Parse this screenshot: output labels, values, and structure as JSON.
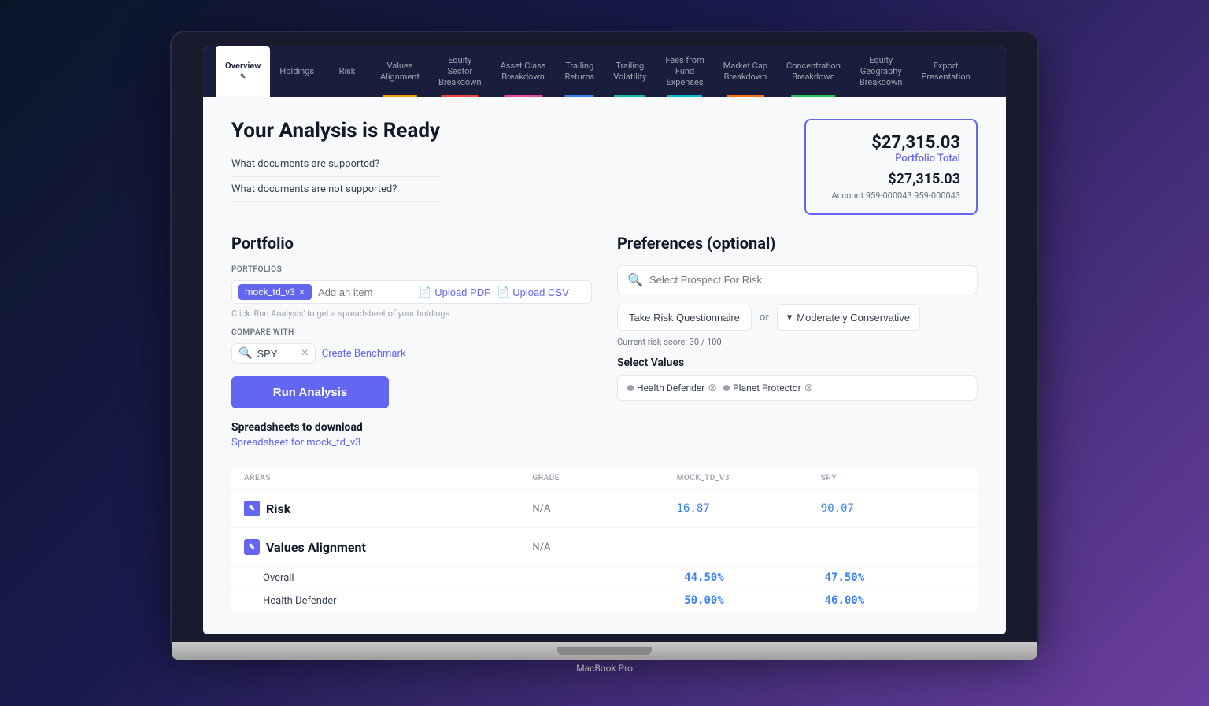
{
  "laptop": {
    "model": "MacBook Pro"
  },
  "nav": {
    "items": [
      {
        "id": "overview",
        "label": "Overview",
        "active": true,
        "color": ""
      },
      {
        "id": "holdings",
        "label": "Holdings",
        "active": false,
        "color": ""
      },
      {
        "id": "risk",
        "label": "Risk",
        "active": false,
        "color": ""
      },
      {
        "id": "values-alignment",
        "label": "Values\nAlignment",
        "active": false,
        "color": "yellow"
      },
      {
        "id": "equity-sector",
        "label": "Equity\nSector\nBreakdown",
        "active": false,
        "color": "red"
      },
      {
        "id": "asset-class",
        "label": "Asset Class\nBreakdown",
        "active": false,
        "color": "pink"
      },
      {
        "id": "trailing-returns",
        "label": "Trailing\nReturns",
        "active": false,
        "color": "blue"
      },
      {
        "id": "trailing-volatility",
        "label": "Trailing\nVolatility",
        "active": false,
        "color": "teal"
      },
      {
        "id": "fees",
        "label": "Fees from\nFund\nExpenses",
        "active": false,
        "color": "cyan"
      },
      {
        "id": "market-cap",
        "label": "Market Cap\nBreakdown",
        "active": false,
        "color": "orange"
      },
      {
        "id": "concentration",
        "label": "Concentration\nBreakdown",
        "active": false,
        "color": "green"
      },
      {
        "id": "equity-geography",
        "label": "Equity\nGeography\nBreakdown",
        "active": false,
        "color": ""
      },
      {
        "id": "export",
        "label": "Export\nPresentation",
        "active": false,
        "color": ""
      }
    ]
  },
  "page": {
    "title": "Your Analysis is Ready",
    "faq1": "What documents are supported?",
    "faq2": "What documents are not supported?"
  },
  "portfolio_card": {
    "amount": "$27,315.03",
    "label": "Portfolio Total",
    "account_amount": "$27,315.03",
    "account_detail": "Account  959-000043  959-000043"
  },
  "portfolio_section": {
    "title": "Portfolio",
    "portfolios_label": "PORTFOLIOS",
    "tag": "mock_td_v3",
    "add_placeholder": "Add an item",
    "click_hint": "Click 'Run Analysis' to get a spreadsheet of your holdings",
    "compare_label": "COMPARE WITH",
    "compare_value": "SPY",
    "create_benchmark": "Create Benchmark",
    "run_analysis": "Run Analysis",
    "spreadsheets_title": "Spreadsheets to download",
    "spreadsheet_link": "Spreadsheet for mock_td_v3",
    "upload_pdf": "Upload PDF",
    "upload_csv": "Upload CSV"
  },
  "preferences_section": {
    "title": "Preferences (optional)",
    "search_placeholder": "Select Prospect For Risk",
    "risk_questionnaire_btn": "Take Risk Questionnaire",
    "or_text": "or",
    "risk_dropdown": "Moderately Conservative",
    "risk_score_text": "Current risk score: 30 / 100",
    "select_values_title": "Select Values",
    "value_tags": [
      "Health Defender",
      "Planet Protector"
    ]
  },
  "table": {
    "columns": [
      "AREAS",
      "GRADE",
      "MOCK_TD_V3",
      "SPY"
    ],
    "rows": [
      {
        "area": "Risk",
        "grade": "N/A",
        "mock_value": "16.87",
        "spy_value": "90.07"
      },
      {
        "area": "Values Alignment",
        "grade": "N/A",
        "mock_value": "",
        "spy_value": "",
        "sub_rows": [
          {
            "label": "Overall",
            "mock_value": "44.50%",
            "spy_value": "47.50%"
          },
          {
            "label": "Health Defender",
            "mock_value": "50.00%",
            "spy_value": "46.00%"
          }
        ]
      }
    ]
  }
}
